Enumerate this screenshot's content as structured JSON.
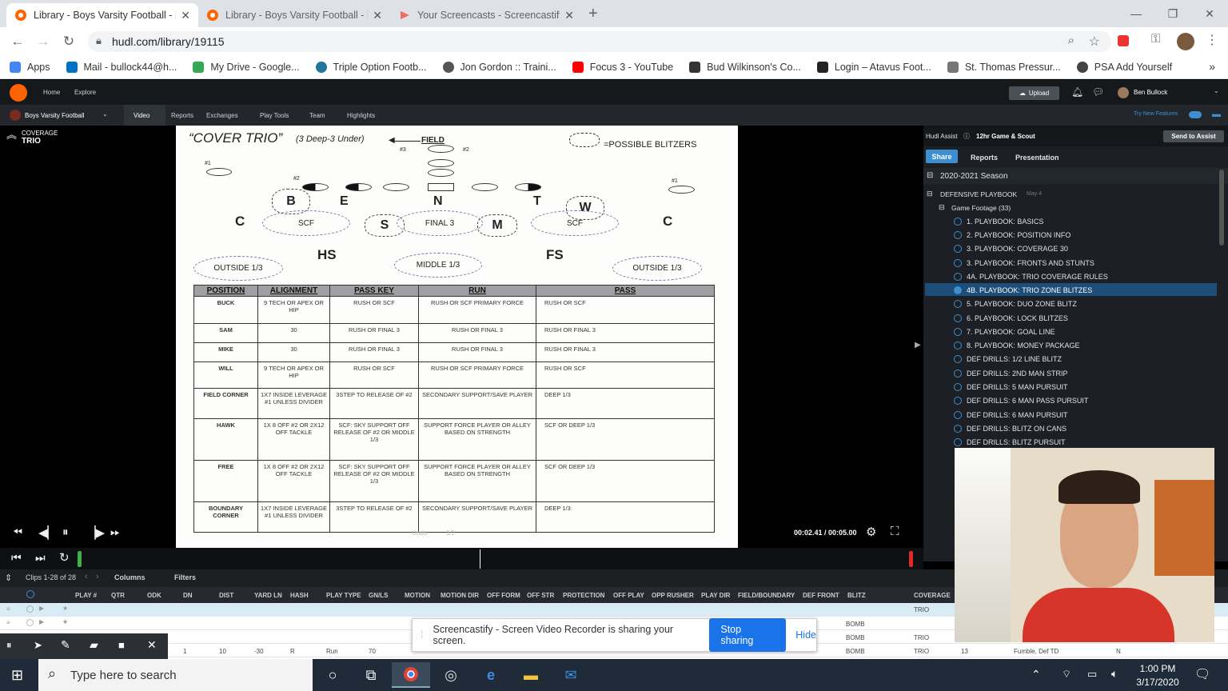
{
  "browser": {
    "tabs": [
      {
        "title": "Library - Boys Varsity Football - H",
        "active": true
      },
      {
        "title": "Library - Boys Varsity Football - H",
        "active": false
      },
      {
        "title": "Your Screencasts - Screencastify",
        "active": false
      }
    ],
    "new_tab": "+",
    "url": "hudl.com/library/19115",
    "bookmarks": [
      {
        "label": "Apps",
        "color": "#4285f4"
      },
      {
        "label": "Mail - bullock44@h...",
        "color": "#0072c6"
      },
      {
        "label": "My Drive - Google...",
        "color": "#34a853"
      },
      {
        "label": "Triple Option Footb...",
        "color": "#21759b"
      },
      {
        "label": "Jon Gordon :: Traini...",
        "color": "#555555"
      },
      {
        "label": "Focus 3 - YouTube",
        "color": "#ff0000"
      },
      {
        "label": "Bud Wilkinson's Co...",
        "color": "#333333"
      },
      {
        "label": "Login – Atavus Foot...",
        "color": "#222222"
      },
      {
        "label": "St. Thomas Pressur...",
        "color": "#777777"
      },
      {
        "label": "PSA Add Yourself",
        "color": "#444444"
      }
    ],
    "more": "»"
  },
  "hudl": {
    "nav": {
      "home": "Home",
      "explore": "Explore",
      "upload": "Upload",
      "user": "Ben Bullock"
    },
    "subnav": {
      "team": "Boys Varsity Football",
      "items": [
        "Video",
        "Reports",
        "Exchanges",
        "Play Tools",
        "Team",
        "Highlights"
      ],
      "try_new": "Try New Features"
    },
    "clip": {
      "line1": "COVERAGE",
      "line2": "TRIO"
    },
    "time": "00:02.41 / 00:05.00",
    "grid": {
      "clips_label": "Clips 1-28 of 28",
      "columns": "Columns",
      "filters": "Filters",
      "headers": [
        "PLAY #",
        "QTR",
        "ODK",
        "DN",
        "DIST",
        "YARD LN",
        "HASH",
        "PLAY TYPE",
        "GN/LS",
        "MOTION",
        "MOTION DIR",
        "OFF FORM",
        "OFF STR",
        "PROTECTION",
        "OFF PLAY",
        "OPP RUSHER",
        "PLAY DIR",
        "FIELD/BOUNDARY",
        "DEF FRONT",
        "BLITZ",
        "COVERAGE"
      ],
      "row1_coverage": "TRIO",
      "row2_blitz": "BOMB",
      "row3": {
        "blitz": "BOMB",
        "coverage": "TRIO"
      },
      "row4": {
        "qtr": "1",
        "dist": "10",
        "yard": "-30",
        "hash": "R",
        "play_type": "Run",
        "gnls": "70",
        "blitz": "BOMB",
        "coverage": "TRIO",
        "extra1": "13",
        "extra2": "Fumble, Def TD",
        "extra3": "N"
      }
    }
  },
  "assist": {
    "label": "Hudl Assist",
    "service": "12hr Game & Scout",
    "send": "Send to Assist",
    "tabs": [
      "Share",
      "Reports",
      "Presentation"
    ],
    "season": "2020-2021 Season",
    "playbook": "DEFENSIVE PLAYBOOK",
    "playbook_date": "May 4",
    "folder": "Game Footage (33)",
    "items": [
      "1. PLAYBOOK: BASICS",
      "2. PLAYBOOK: POSITION INFO",
      "3. PLAYBOOK: COVERAGE 30",
      "3. PLAYBOOK: FRONTS AND STUNTS",
      "4A. PLAYBOOK: TRIO COVERAGE RULES",
      "4B. PLAYBOOK: TRIO ZONE BLITZES",
      "5. PLAYBOOK: DUO ZONE BLITZ",
      "6. PLAYBOOK: LOCK BLITZES",
      "7. PLAYBOOK: GOAL LINE",
      "8. PLAYBOOK: MONEY PACKAGE",
      "DEF DRILLS: 1/2 LINE BLITZ",
      "DEF DRILLS: 2ND MAN STRIP",
      "DEF DRILLS: 5 MAN PURSUIT",
      "DEF DRILLS: 6 MAN PASS PURSUIT",
      "DEF DRILLS: 6 MAN PURSUIT",
      "DEF DRILLS: BLITZ ON CANS",
      "DEF DRILLS: BLITZ PURSUIT"
    ],
    "selected_index": 5
  },
  "slide": {
    "title": "“COVER TRIO”",
    "subtitle": "(3 Deep-3 Under)",
    "field": "FIELD",
    "blitzers": "=POSSIBLE BLITZERS",
    "letters": {
      "b": "B",
      "e": "E",
      "n": "N",
      "t": "T",
      "w": "W",
      "c": "C",
      "s": "S",
      "m": "M",
      "hs": "HS",
      "fs": "FS"
    },
    "zones": {
      "scf": "SCF",
      "final3": "FINAL 3",
      "outside": "OUTSIDE 1/3",
      "middle": "MIDDLE 1/3"
    },
    "marks": {
      "n1": "#1",
      "n2": "#2",
      "n3": "#3"
    },
    "table_headers": [
      "POSITION",
      "ALIGNMENT",
      "PASS KEY",
      "RUN",
      "PASS"
    ],
    "rows": [
      [
        "BUCK",
        "9 TECH OR APEX OR HIP",
        "RUSH OR SCF",
        "RUSH OR SCF PRIMARY FORCE",
        "RUSH OR SCF"
      ],
      [
        "SAM",
        "30",
        "RUSH OR FINAL 3",
        "RUSH OR FINAL 3",
        "RUSH OR FINAL 3"
      ],
      [
        "MIKE",
        "30",
        "RUSH OR FINAL 3",
        "RUSH OR FINAL 3",
        "RUSH OR FINAL 3"
      ],
      [
        "WILL",
        "9 TECH OR APEX OR HIP",
        "RUSH OR SCF",
        "RUSH OR SCF PRIMARY FORCE",
        "RUSH OR  SCF"
      ],
      [
        "FIELD CORNER",
        "1X7 INSIDE LEVERAGE #1 UNLESS DIVIDER",
        "3STEP TO RELEASE OF #2",
        "SECONDARY SUPPORT/SAVE PLAYER",
        "DEEP 1/3"
      ],
      [
        "HAWK",
        "1X 8 OFF #2 OR 2X12 OFF TACKLE",
        "SCF: SKY SUPPORT OFF RELEASE OF #2 OR MIDDLE 1/3",
        "SUPPORT FORCE PLAYER OR ALLEY BASED ON STRENGTH",
        "SCF OR DEEP 1/3"
      ],
      [
        "FREE",
        "1X 8 OFF #2 OR 2X12 OFF TACKLE",
        "SCF: SKY SUPPORT OFF RELEASE OF #2 OR MIDDLE 1/3",
        "SUPPORT FORCE PLAYER OR ALLEY BASED ON STRENGTH",
        "SCF OR DEEP 1/3"
      ],
      [
        "BOUNDARY CORNER",
        "1X7 INSIDE LEVERAGE #1 UNLESS DIVIDER",
        "3STEP TO RELEASE OF #2",
        "SECONDARY SUPPORT/SAVE PLAYER",
        "DEEP 1/3"
      ]
    ],
    "overlay": {
      "undo": "Undo",
      "half": "1/2"
    }
  },
  "screencastify": {
    "message": "Screencastify - Screen Video Recorder is sharing your screen.",
    "stop": "Stop sharing",
    "hide": "Hide"
  },
  "taskbar": {
    "search": "Type here to search",
    "time": "1:00 PM",
    "date": "3/17/2020"
  }
}
